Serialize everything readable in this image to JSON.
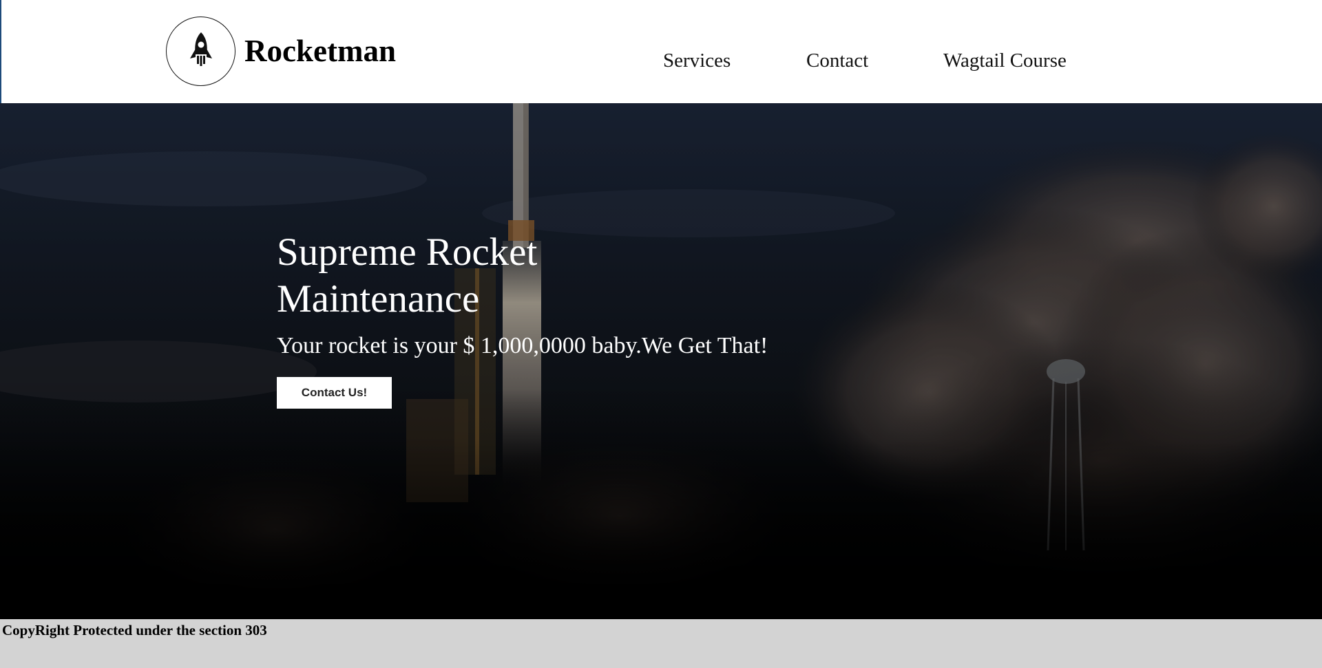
{
  "header": {
    "brand": "Rocketman",
    "logo_icon": "rocket-icon",
    "nav": [
      {
        "label": "Services"
      },
      {
        "label": "Contact"
      },
      {
        "label": "Wagtail Course"
      }
    ]
  },
  "hero": {
    "title": "Supreme Rocket Maintenance",
    "subtitle": "Your rocket is your $ 1,000,0000 baby.We Get That!",
    "cta_label": "Contact Us!"
  },
  "footer": {
    "text": "CopyRight Protected under the section 303"
  },
  "colors": {
    "header_bg": "#ffffff",
    "footer_bg": "#d3d3d3",
    "hero_text": "#ffffff",
    "button_bg": "#ffffff"
  }
}
